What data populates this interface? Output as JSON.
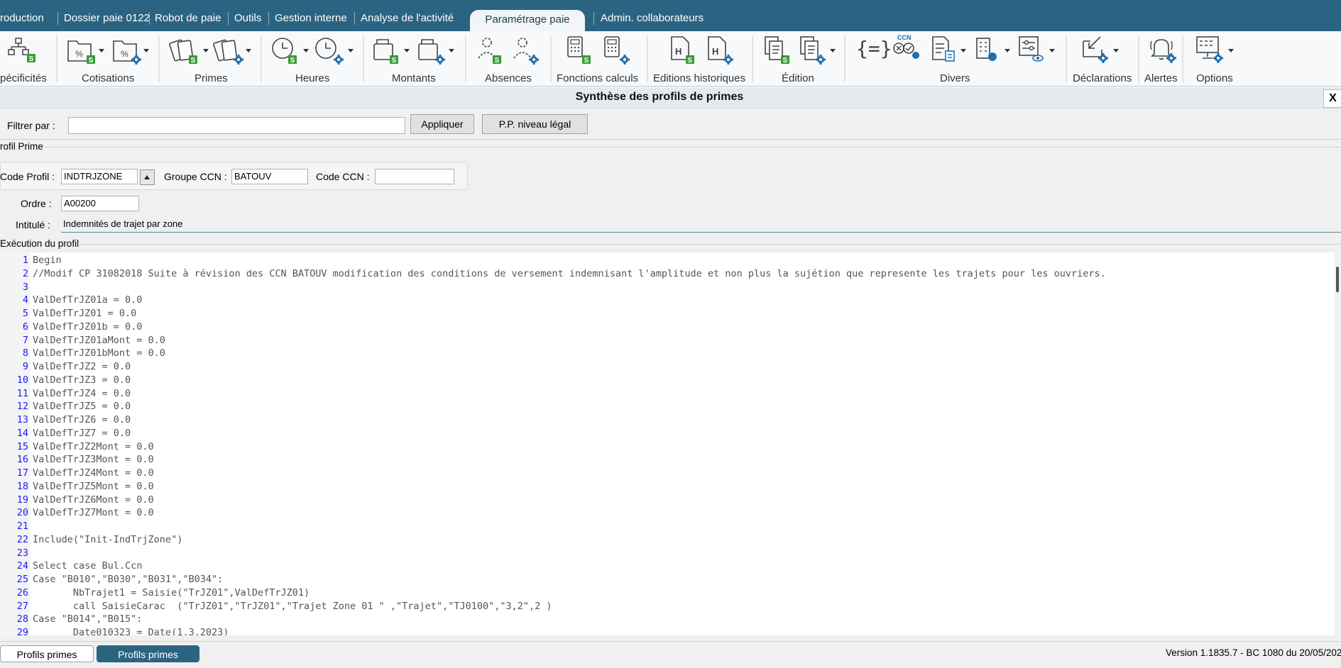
{
  "tabs": [
    {
      "label": "roduction"
    },
    {
      "label": "Dossier paie 0122"
    },
    {
      "label": "Robot de paie"
    },
    {
      "label": "Outils"
    },
    {
      "label": "Gestion interne"
    },
    {
      "label": "Analyse de l'activité"
    },
    {
      "label": "Paramétrage paie",
      "active": true
    },
    {
      "label": "Admin. collaborateurs"
    }
  ],
  "ribbon": {
    "groups": [
      {
        "label": "pécificités",
        "icons": [
          "org-chart-icon"
        ]
      },
      {
        "label": "Cotisations",
        "icons": [
          "percent-folder-icon",
          "percent-folder-gear-icon"
        ]
      },
      {
        "label": "Primes",
        "icons": [
          "bonus-icon",
          "bonus-gear-icon"
        ]
      },
      {
        "label": "Heures",
        "icons": [
          "clock-icon",
          "clock-gear-icon"
        ]
      },
      {
        "label": "Montants",
        "icons": [
          "wallet-icon",
          "wallet-gear-icon"
        ]
      },
      {
        "label": "Absences",
        "icons": [
          "absence-icon",
          "absence-gear-icon"
        ]
      },
      {
        "label": "Fonctions calculs",
        "icons": [
          "calculator-icon",
          "calculator-gear-icon"
        ]
      },
      {
        "label": "Editions historiques",
        "icons": [
          "history-doc-icon",
          "history-doc-gear-icon"
        ]
      },
      {
        "label": "Édition",
        "icons": [
          "edition-icon",
          "edition-gear-icon"
        ]
      },
      {
        "label": "Divers",
        "icons": [
          "braces-icon",
          "ccn-icon",
          "checklist-icon",
          "building-icon",
          "settings-eye-icon"
        ]
      },
      {
        "label": "Déclarations",
        "icons": [
          "declaration-icon"
        ]
      },
      {
        "label": "Alertes",
        "icons": [
          "bell-icon"
        ]
      },
      {
        "label": "Options",
        "icons": [
          "options-icon"
        ]
      }
    ],
    "badge_s": "S",
    "ccn_badge": "CCN"
  },
  "panel": {
    "title": "Synthèse des profils de primes",
    "close": "X"
  },
  "filter": {
    "label": "Filtrer par :",
    "value": "",
    "apply_label": "Appliquer",
    "pp_label": "P.P. niveau légal"
  },
  "profil": {
    "section_label": "rofil Prime",
    "code_label": "Code Profil :",
    "code_value": "INDTRJZONE",
    "groupe_label": "Groupe CCN :",
    "groupe_value": "BATOUV",
    "ccn_label": "Code CCN :",
    "ccn_value": "",
    "ordre_label": "Ordre :",
    "ordre_value": "A00200",
    "intitule_label": "Intitulé :",
    "intitule_value": "Indemnités de trajet par zone"
  },
  "execution": {
    "section_label": "Exécution du profil",
    "lines": [
      {
        "n": "1",
        "t": "Begin"
      },
      {
        "n": "2",
        "t": "//Modif CP 31082018 Suite à révision des CCN BATOUV modification des conditions de versement indemnisant l'amplitude et non plus la sujétion que represente les trajets pour les ouvriers."
      },
      {
        "n": "3",
        "t": ""
      },
      {
        "n": "4",
        "t": "ValDefTrJZ01a = 0.0"
      },
      {
        "n": "5",
        "t": "ValDefTrJZ01 = 0.0"
      },
      {
        "n": "6",
        "t": "ValDefTrJZ01b = 0.0"
      },
      {
        "n": "7",
        "t": "ValDefTrJZ01aMont = 0.0"
      },
      {
        "n": "8",
        "t": "ValDefTrJZ01bMont = 0.0"
      },
      {
        "n": "9",
        "t": "ValDefTrJZ2 = 0.0"
      },
      {
        "n": "10",
        "t": "ValDefTrJZ3 = 0.0"
      },
      {
        "n": "11",
        "t": "ValDefTrJZ4 = 0.0"
      },
      {
        "n": "12",
        "t": "ValDefTrJZ5 = 0.0"
      },
      {
        "n": "13",
        "t": "ValDefTrJZ6 = 0.0"
      },
      {
        "n": "14",
        "t": "ValDefTrJZ7 = 0.0"
      },
      {
        "n": "15",
        "t": "ValDefTrJZ2Mont = 0.0"
      },
      {
        "n": "16",
        "t": "ValDefTrJZ3Mont = 0.0"
      },
      {
        "n": "17",
        "t": "ValDefTrJZ4Mont = 0.0"
      },
      {
        "n": "18",
        "t": "ValDefTrJZ5Mont = 0.0"
      },
      {
        "n": "19",
        "t": "ValDefTrJZ6Mont = 0.0"
      },
      {
        "n": "20",
        "t": "ValDefTrJZ7Mont = 0.0"
      },
      {
        "n": "21",
        "t": ""
      },
      {
        "n": "22",
        "t": "Include(\"Init-IndTrjZone\")"
      },
      {
        "n": "23",
        "t": ""
      },
      {
        "n": "24",
        "t": "Select case Bul.Ccn"
      },
      {
        "n": "25",
        "t": "Case \"B010\",\"B030\",\"B031\",\"B034\":"
      },
      {
        "n": "26",
        "t": "       NbTrajet1 = Saisie(\"TrJZ01\",ValDefTrJZ01)"
      },
      {
        "n": "27",
        "t": "       call SaisieCarac  (\"TrJZ01\",\"TrJZ01\",\"Trajet Zone 01 \" ,\"Trajet\",\"TJ0100\",\"3,2\",2 )"
      },
      {
        "n": "28",
        "t": "Case \"B014\",\"B015\":"
      },
      {
        "n": "29",
        "t": "       Date010323 = Date(1,3,2023)"
      }
    ]
  },
  "bottom": {
    "tab1": "Profils primes",
    "tab2": "Profils primes",
    "version": "Version 1.1835.7 - BC 1080 du 20/05/202"
  },
  "colors": {
    "tabbar": "#2b6482",
    "accent_green": "#3a9a3a",
    "accent_blue": "#1f6fb2",
    "line_number": "#1a1aff"
  }
}
